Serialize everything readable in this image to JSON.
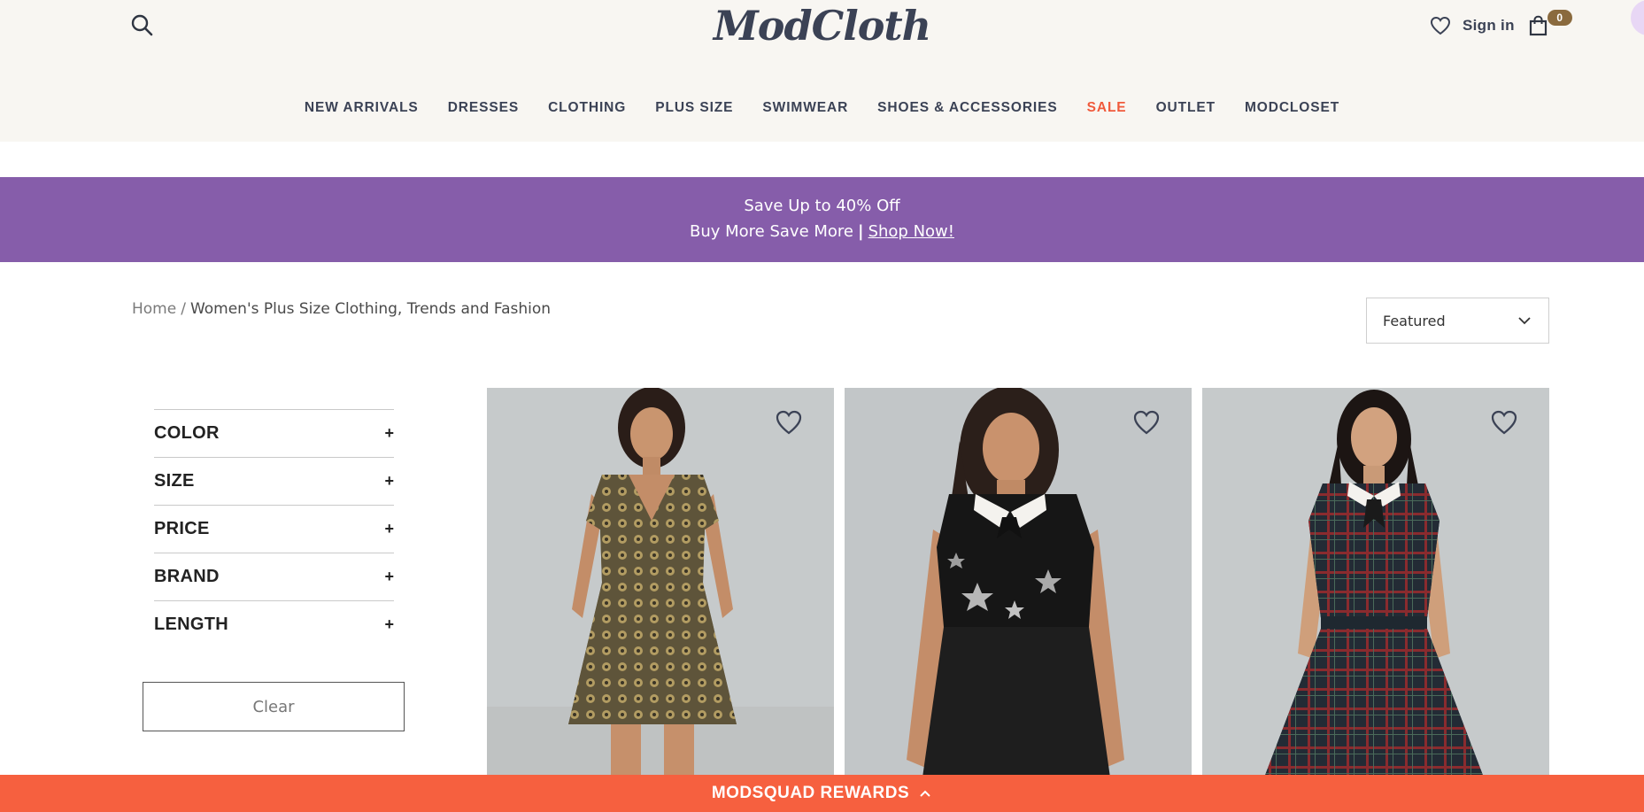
{
  "header": {
    "logo": "ModCloth",
    "sign_in_label": "Sign in",
    "cart_count": "0"
  },
  "nav": {
    "items": [
      {
        "label": "NEW ARRIVALS"
      },
      {
        "label": "DRESSES"
      },
      {
        "label": "CLOTHING"
      },
      {
        "label": "PLUS SIZE"
      },
      {
        "label": "SWIMWEAR"
      },
      {
        "label": "SHOES & ACCESSORIES"
      },
      {
        "label": "SALE",
        "color": "#f05a3c"
      },
      {
        "label": "OUTLET"
      },
      {
        "label": "MODCLOSET"
      }
    ]
  },
  "promo": {
    "line1": "Save Up to 40% Off",
    "line2": "Buy More Save More",
    "separator": "|",
    "link_label": "Shop Now!",
    "background": "#865daa"
  },
  "breadcrumb": {
    "home": "Home",
    "separator": "/",
    "current": "Women's Plus Size Clothing, Trends and Fashion"
  },
  "sort": {
    "selected": "Featured"
  },
  "filters": {
    "items": [
      {
        "label": "COLOR",
        "toggle": "+"
      },
      {
        "label": "SIZE",
        "toggle": "+"
      },
      {
        "label": "PRICE",
        "toggle": "+"
      },
      {
        "label": "BRAND",
        "toggle": "+"
      },
      {
        "label": "LENGTH",
        "toggle": "+"
      }
    ],
    "clear_label": "Clear"
  },
  "products": [
    {
      "dress": "gold-brocade-dress",
      "accent": "#a08a55"
    },
    {
      "dress": "black-star-sequin-dress",
      "accent": "#1a1a1a"
    },
    {
      "dress": "plaid-collar-dress",
      "accent": "#26303a"
    }
  ],
  "rewards": {
    "label": "MODSQUAD REWARDS",
    "background": "#f6603f"
  },
  "icons": {
    "search": "search-icon",
    "wishlist": "heart-icon",
    "cart": "shopping-bag-icon",
    "sort": "chevron-down-icon",
    "rewards": "chevron-up-icon"
  }
}
